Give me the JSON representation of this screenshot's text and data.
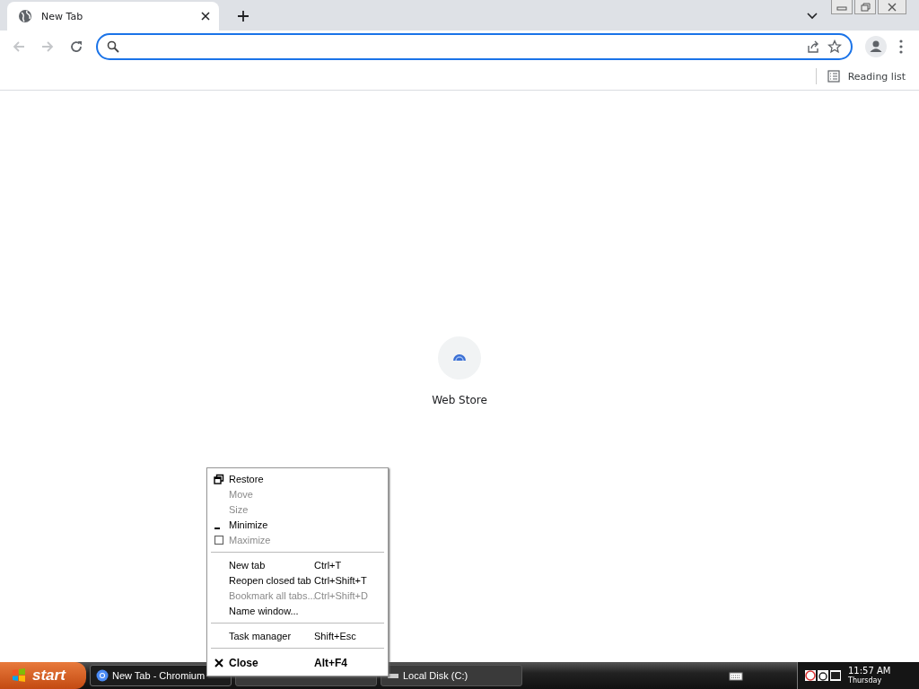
{
  "browser": {
    "tabs": [
      {
        "title": "New Tab",
        "selected": true
      }
    ],
    "bookmarks_bar": {
      "reading_list": "Reading list"
    },
    "new_tab_page": {
      "shortcuts": [
        {
          "label": "Web Store"
        }
      ]
    }
  },
  "context_menu": {
    "sections": [
      {
        "items": [
          {
            "label": "Restore",
            "kind": "restore",
            "disabled": false,
            "bold": false
          },
          {
            "label": "Move",
            "kind": "plain",
            "disabled": true,
            "bold": false
          },
          {
            "label": "Size",
            "kind": "plain",
            "disabled": true,
            "bold": false
          },
          {
            "label": "Minimize",
            "kind": "minimize",
            "disabled": false,
            "bold": false
          },
          {
            "label": "Maximize",
            "kind": "maximize",
            "disabled": true,
            "bold": false
          }
        ]
      },
      {
        "items": [
          {
            "label": "New tab",
            "shortcut": "Ctrl+T",
            "disabled": false,
            "bold": false
          },
          {
            "label": "Reopen closed tab",
            "shortcut": "Ctrl+Shift+T",
            "disabled": false,
            "bold": false
          },
          {
            "label": "Bookmark all tabs...",
            "shortcut": "Ctrl+Shift+D",
            "disabled": true,
            "bold": false
          },
          {
            "label": "Name window...",
            "disabled": false,
            "bold": false
          }
        ]
      },
      {
        "items": [
          {
            "label": "Task manager",
            "shortcut": "Shift+Esc",
            "disabled": false,
            "bold": false
          }
        ]
      },
      {
        "items": [
          {
            "label": "Close",
            "shortcut": "Alt+F4",
            "kind": "close",
            "disabled": false,
            "bold": true
          }
        ]
      }
    ]
  },
  "taskbar": {
    "start": "start",
    "tasks": [
      {
        "label": "New Tab - Chromium",
        "selected": true,
        "kind": "browser"
      },
      {
        "selected": false,
        "kind": "hidden"
      },
      {
        "label": "Local Disk (C:)",
        "selected": false,
        "kind": "drive"
      }
    ],
    "clock": {
      "time": "11:57 AM",
      "day": "Thursday"
    }
  }
}
